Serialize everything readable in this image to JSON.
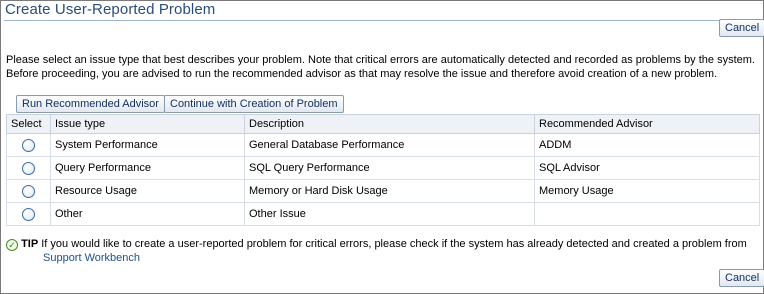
{
  "page": {
    "title": "Create User-Reported Problem",
    "cancel_label": "Cancel",
    "intro_line1": "Please select an issue type that best describes your problem. Note that critical errors are automatically detected and recorded as problems by the system.",
    "intro_line2": "Before proceeding, you are advised to run the recommended advisor as that may resolve the issue and therefore avoid creation of a new problem."
  },
  "actions": {
    "run_label": "Run Recommended Advisor",
    "continue_label": "Continue with Creation of Problem"
  },
  "table": {
    "headers": [
      "Select",
      "Issue type",
      "Description",
      "Recommended Advisor"
    ],
    "rows": [
      {
        "issue_type": "System Performance",
        "description": "General Database Performance",
        "advisor": "ADDM"
      },
      {
        "issue_type": "Query Performance",
        "description": "SQL Query Performance",
        "advisor": "SQL Advisor"
      },
      {
        "issue_type": "Resource Usage",
        "description": "Memory or Hard Disk Usage",
        "advisor": "Memory Usage"
      },
      {
        "issue_type": "Other",
        "description": "Other Issue",
        "advisor": ""
      }
    ]
  },
  "tip": {
    "icon": "checkmark-icon",
    "label": "TIP",
    "text": "If you would like to create a user-reported problem for critical errors, please check if the system has already detected and created a problem from",
    "link_text": "Support Workbench"
  },
  "colors": {
    "title": "#2b4d7a",
    "link": "#1d4e8f",
    "header_bg": "#eef2f7"
  }
}
